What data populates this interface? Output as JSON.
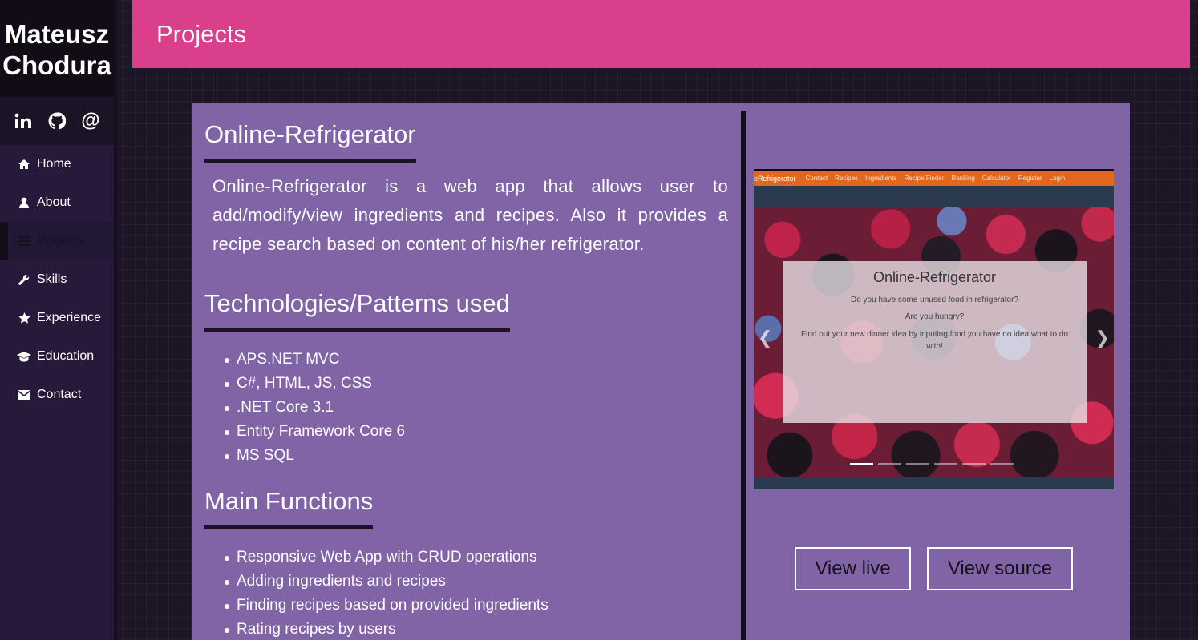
{
  "sidebar": {
    "brand_line1": "Mateusz",
    "brand_line2": "Chodura",
    "socials": [
      {
        "icon": "linkedin-icon"
      },
      {
        "icon": "github-icon"
      },
      {
        "icon": "at-icon",
        "label": "@"
      }
    ],
    "nav": [
      {
        "label": "Home",
        "icon": "home-icon"
      },
      {
        "label": "About",
        "icon": "user-icon"
      },
      {
        "label": "Projects",
        "icon": "list-icon",
        "active": true
      },
      {
        "label": "Skills",
        "icon": "wrench-icon"
      },
      {
        "label": "Experience",
        "icon": "star-icon"
      },
      {
        "label": "Education",
        "icon": "graduation-cap-icon"
      },
      {
        "label": "Contact",
        "icon": "envelope-icon"
      }
    ]
  },
  "header": {
    "title": "Projects"
  },
  "project": {
    "title": "Online-Refrigerator",
    "description": "Online-Refrigerator is a web app that allows user to add/modify/view ingredients and recipes. Also it provides a recipe search based on content of his/her refrigerator.",
    "tech_heading": "Technologies/Patterns used",
    "technologies": [
      "APS.NET MVC",
      "C#, HTML, JS, CSS",
      ".NET Core 3.1",
      "Entity Framework Core 6",
      "MS SQL"
    ],
    "functions_heading": "Main Functions",
    "functions": [
      "Responsive Web App with CRUD operations",
      "Adding ingredients and recipes",
      "Finding recipes based on provided ingredients",
      "Rating recipes by users"
    ],
    "preview": {
      "brand": "eRefrigerator",
      "nav": [
        "Contact",
        "Recipes",
        "Ingredients",
        "Recipe Finder",
        "Ranking",
        "Calculator",
        "Register",
        "Login"
      ],
      "hero_title": "Online-Refrigerator",
      "line1": "Do you have some unused food in refrigerator?",
      "line2": "Are you hungry?",
      "line3": "Find out your new dinner idea by inputing food you have no idea what to do with!"
    },
    "view_live_label": "View live",
    "view_source_label": "View source"
  },
  "colors": {
    "header": "#d93f8a",
    "card": "#8064a6",
    "sidebar": "#26193a",
    "preview_nav": "#e2661e"
  }
}
